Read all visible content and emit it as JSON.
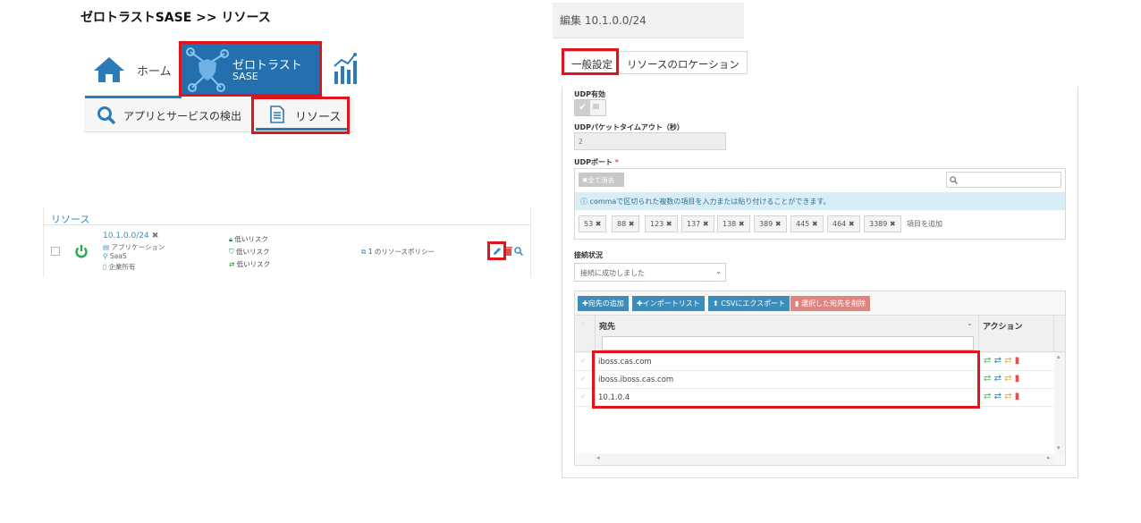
{
  "breadcrumb": "ゼロトラストSASE >> リソース",
  "nav": {
    "home": "ホーム",
    "zt_line1": "ゼロトラスト",
    "zt_line2": "SASE",
    "discover": "アプリとサービスの検出",
    "resources": "リソース"
  },
  "resource_list": {
    "header": "リソース",
    "row": {
      "name": "10.1.0.0/24",
      "remove": "✖",
      "meta": [
        "アプリケーション",
        "SaaS",
        "企業所有"
      ],
      "risks": [
        "低いリスク",
        "低いリスク",
        "低いリスク"
      ],
      "policy": "1 のリソースポリシー"
    }
  },
  "dialog": {
    "title": "編集 10.1.0.0/24",
    "tabs": [
      "一般設定",
      "リソースのロケーション"
    ],
    "udp_enabled_label": "UDP有効",
    "toggle_bars": "III",
    "udp_timeout_label": "UDPパケットタイムアウト（秒）",
    "udp_timeout_value": "2",
    "udp_port_label": "UDPポート",
    "required_mark": "*",
    "clear_all": "✖全て消去",
    "info_text": "commaで区切られた複数の項目を入力または貼り付けることができます。",
    "ports": [
      "53",
      "88",
      "123",
      "137",
      "138",
      "389",
      "445",
      "464",
      "3389"
    ],
    "add_item": "項目を追加",
    "connection_label": "接続状況",
    "connection_value": "接続に成功しました",
    "toolbar": {
      "add_dest": "✚宛先の追加",
      "import": "✚インポートリスト",
      "export": "CSVにエクスポート",
      "delete": "選択した宛先を削除"
    },
    "grid": {
      "col_dest": "宛先",
      "col_actions": "アクション",
      "rows": [
        "iboss.cas.com",
        "iboss.iboss.cas.com",
        "10.1.0.4"
      ]
    }
  },
  "colors": {
    "accent": "#2b7bb9",
    "nav_active": "#2470ae",
    "highlight": "#e0141b",
    "info_bg": "#d9edf7"
  }
}
